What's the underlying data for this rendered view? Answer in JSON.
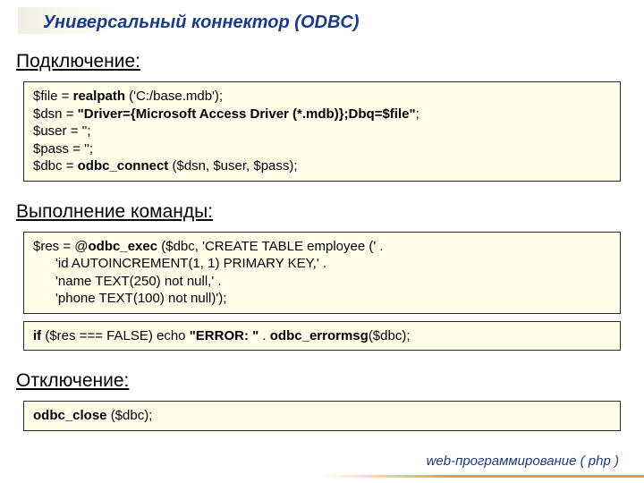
{
  "header": {
    "title": "Универсальный коннектор (ODBC)"
  },
  "sections": {
    "connect": {
      "heading": "Подключение:",
      "code": {
        "l1a": "$file = ",
        "l1b": "realpath",
        "l1c": " ('C:/base.mdb');",
        "l2a": "$dsn = ",
        "l2b": "\"Driver={Microsoft Access Driver (*.mdb)};Dbq=$file\"",
        "l2c": ";",
        "l3": "$user = '';",
        "l4": "$pass = '';",
        "l5a": "$dbc = ",
        "l5b": "odbc_connect",
        "l5c": " ($dsn, $user, $pass);"
      }
    },
    "exec": {
      "heading": "Выполнение команды:",
      "box1": {
        "l1a": "$res = @",
        "l1b": "odbc_exec",
        "l1c": " ($dbc, 'CREATE TABLE employee (' .",
        "l2": "      'id AUTOINCREMENT(1, 1) PRIMARY KEY,' .",
        "l3": "      'name TEXT(250) not null,' .",
        "l4": "      'phone TEXT(100) not null)');"
      },
      "box2": {
        "l1a": "if ",
        "l1b": "($res === FALSE) echo ",
        "l1c": "\"ERROR: \"",
        "l1d": " . ",
        "l1e": "odbc_errormsg",
        "l1f": "($dbc);"
      }
    },
    "disconnect": {
      "heading": "Отключение:",
      "code": {
        "l1a": "odbc_close",
        "l1b": " ($dbc);"
      }
    }
  },
  "footer": {
    "text": "web-программирование ( php )"
  }
}
